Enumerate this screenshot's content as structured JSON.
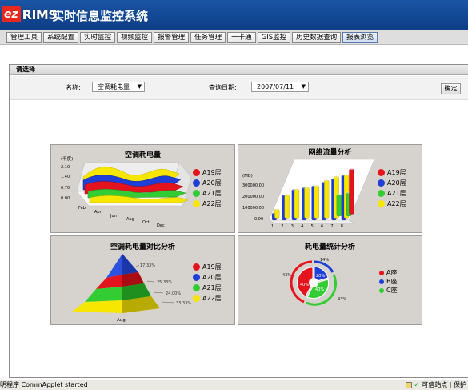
{
  "app": {
    "logo_ez": "ez",
    "logo_rims": "RIMS",
    "title": "实时信息监控系统"
  },
  "menu": [
    {
      "label": "管理工具"
    },
    {
      "label": "系统配置"
    },
    {
      "label": "实时监控"
    },
    {
      "label": "视频监控"
    },
    {
      "label": "报警管理"
    },
    {
      "label": "任务管理"
    },
    {
      "label": "一卡通"
    },
    {
      "label": "GIS监控"
    },
    {
      "label": "历史数据查询"
    },
    {
      "label": "报表浏览",
      "active": true
    }
  ],
  "filter": {
    "section_title": "请选择",
    "name_label": "名称:",
    "name_value": "空调耗电量",
    "date_label": "查询日期:",
    "date_value": "2007/07/11",
    "confirm_label": "确定"
  },
  "colors": {
    "red": "#e3141e",
    "blue": "#1f3ed6",
    "green": "#33cc33",
    "yellow": "#f6e600"
  },
  "chart_data": [
    {
      "type": "area",
      "title": "空调耗电量",
      "ylabel": "(千度)",
      "y_ticks": [
        "2.10",
        "1.40",
        "0.70",
        "0.00"
      ],
      "x_ticks": [
        "Feb",
        "Apr",
        "Jun",
        "Aug",
        "Oct",
        "Dec"
      ],
      "ylim": [
        0,
        2.1
      ],
      "series": [
        {
          "name": "A19层",
          "color": "#e3141e"
        },
        {
          "name": "A20层",
          "color": "#1f3ed6"
        },
        {
          "name": "A21层",
          "color": "#33cc33"
        },
        {
          "name": "A22层",
          "color": "#f6e600"
        }
      ]
    },
    {
      "type": "bar",
      "title": "网络流量分析",
      "ylabel": "(MB)",
      "y_ticks": [
        "300000.00",
        "200000.00",
        "100000.00",
        "0.00"
      ],
      "categories": [
        "1",
        "2",
        "3",
        "4",
        "5",
        "6",
        "7",
        "8"
      ],
      "ylim": [
        0,
        300000
      ],
      "series": [
        {
          "name": "A19层",
          "color": "#e3141e",
          "values": [
            0,
            0,
            0,
            0,
            0,
            0,
            0,
            250000
          ]
        },
        {
          "name": "A20层",
          "color": "#1f3ed6",
          "values": [
            40000,
            140000,
            170000,
            180000,
            190000,
            210000,
            230000,
            250000
          ]
        },
        {
          "name": "A21层",
          "color": "#33cc33",
          "values": [
            0,
            0,
            0,
            0,
            0,
            0,
            120000,
            130000
          ]
        },
        {
          "name": "A22层",
          "color": "#f6e600",
          "values": [
            50000,
            130000,
            160000,
            170000,
            180000,
            210000,
            230000,
            240000
          ]
        }
      ]
    },
    {
      "type": "pie",
      "title": "空调耗电量对比分析",
      "xlabel": "Aug",
      "series": [
        {
          "name": "A19层",
          "color": "#e3141e",
          "value": 24.0,
          "label": "24.00%"
        },
        {
          "name": "A20层",
          "color": "#1f3ed6",
          "value": 17.33,
          "label": "17.33%"
        },
        {
          "name": "A21层",
          "color": "#33cc33",
          "value": 25.33,
          "label": "25.33%"
        },
        {
          "name": "A22层",
          "color": "#f6e600",
          "value": 33.33,
          "label": "33.33%"
        }
      ]
    },
    {
      "type": "pie",
      "title": "耗电量统计分析",
      "series": [
        {
          "name": "A座",
          "color": "#e3141e",
          "outer_label": "43%",
          "inner_label": "40%"
        },
        {
          "name": "B座",
          "color": "#1f3ed6",
          "outer_label": "14%",
          "inner_label": "20%"
        },
        {
          "name": "C座",
          "color": "#33cc33",
          "outer_label": "43%",
          "inner_label": "40%"
        }
      ]
    }
  ],
  "status": {
    "left": "明程序 CommApplet started",
    "right": "可信站点 | 保护"
  }
}
